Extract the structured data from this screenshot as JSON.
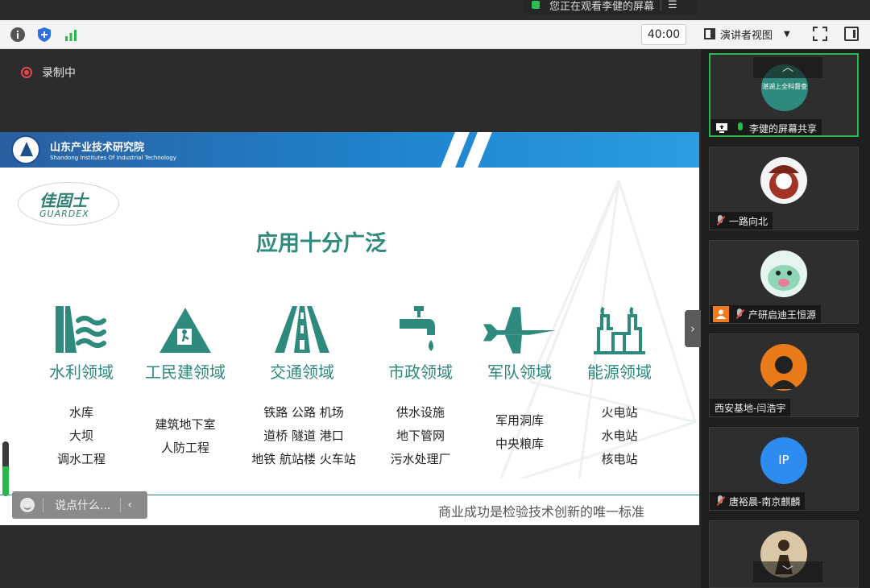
{
  "banner": {
    "text": "您正在观看李健的屏幕",
    "camera_icon": "camera-icon",
    "menu_icon": "menu-icon"
  },
  "toolbar": {
    "timer": "40:00",
    "view_label": "演讲者视图",
    "view_icon": "speaker-view-icon",
    "left_icons": [
      "info-icon",
      "shield-icon",
      "signal-icon"
    ],
    "right_icons": [
      "fullscreen-icon",
      "side-panel-icon"
    ]
  },
  "recording": {
    "label": "录制中"
  },
  "slide": {
    "org_name": "山东产业技术研究院",
    "org_name_en": "Shandong Institutes Of Industrial Technology",
    "logo_cn": "佳固士",
    "logo_en": "GUARDEX",
    "title": "应用十分广泛",
    "categories": [
      {
        "icon": "water-dam-icon",
        "label": "水利领域",
        "items": [
          "水库",
          "大坝",
          "调水工程"
        ]
      },
      {
        "icon": "civil-construction-icon",
        "label": "工民建领域",
        "items": [
          "建筑地下室",
          "人防工程"
        ]
      },
      {
        "icon": "road-icon",
        "label": "交通领域",
        "items": [
          "铁路  公路  机场",
          "道桥  隧道  港口",
          "地铁  航站楼  火车站"
        ]
      },
      {
        "icon": "water-tap-icon",
        "label": "市政领域",
        "items": [
          "供水设施",
          "地下管网",
          "污水处理厂"
        ]
      },
      {
        "icon": "fighter-jet-icon",
        "label": "军队领域",
        "items": [
          "军用洞库",
          "中央粮库"
        ]
      },
      {
        "icon": "power-plant-icon",
        "label": "能源领域",
        "items": [
          "火电站",
          "水电站",
          "核电站"
        ]
      }
    ],
    "slogan": "商业成功是检验技术创新的唯一标准"
  },
  "chat": {
    "placeholder": "说点什么...",
    "collapse_glyph": "‹"
  },
  "audio_level": 0.55,
  "colors": {
    "accent": "#2e8a7c",
    "header_blue": "#1f86d0",
    "active_green": "#29b84a",
    "muted_red": "#e5484d"
  },
  "participants": [
    {
      "name": "李健的屏幕共享",
      "avatar_text": "湛湖上全科督查",
      "mic": "on",
      "badge": "screen-share-icon"
    },
    {
      "name": "一路向北",
      "mic": "muted",
      "badge": ""
    },
    {
      "name": "产研启迪王恒源",
      "mic": "muted",
      "badge": "user-icon"
    },
    {
      "name": "西安基地-闫浩宇",
      "mic": "none",
      "badge": ""
    },
    {
      "name": "唐裕晨-南京麒麟",
      "avatar_text": "IP",
      "mic": "muted",
      "badge": ""
    }
  ],
  "side_collapse_glyph": "›",
  "scroll": {
    "up": "︿",
    "down": "﹀"
  }
}
